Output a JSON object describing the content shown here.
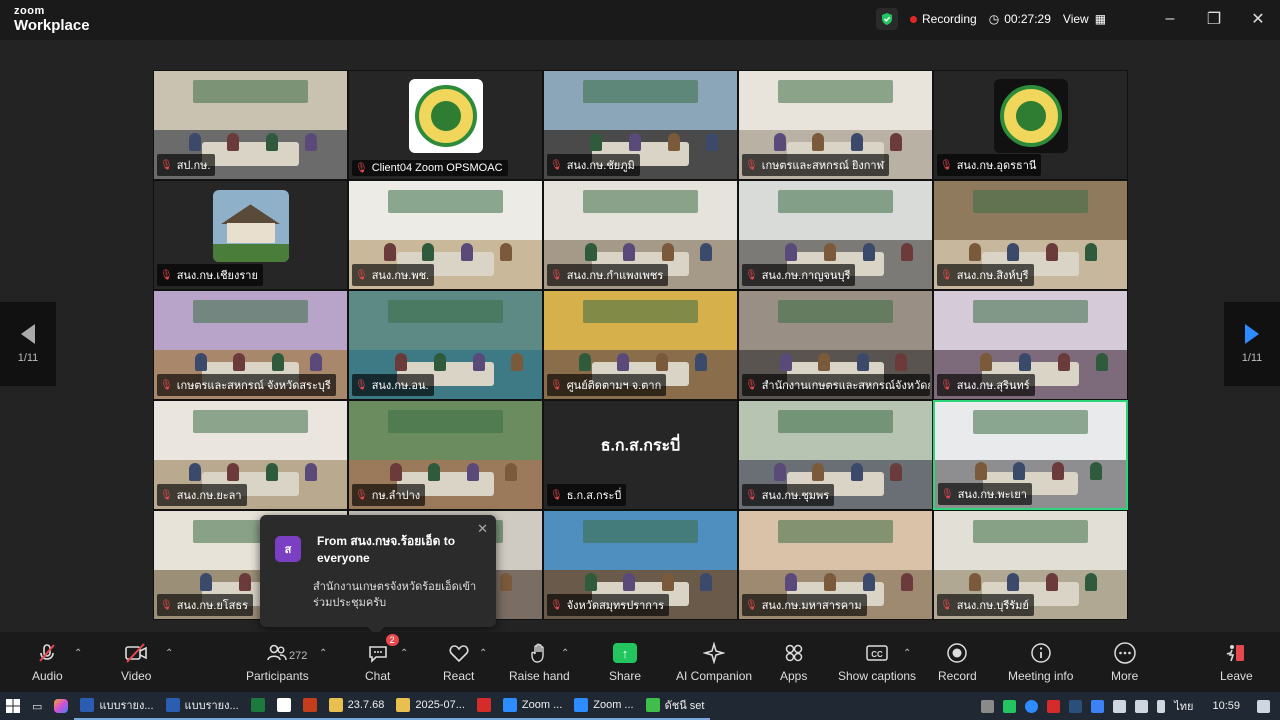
{
  "app": {
    "brand_top": "zoom",
    "brand_bottom": "Workplace"
  },
  "header": {
    "recording": "Recording",
    "timer": "00:27:29",
    "view": "View"
  },
  "gallery": {
    "page_left": "1/11",
    "page_right": "1/11",
    "tiles": [
      {
        "name": "สป.กษ.",
        "kind": "room",
        "wall": "#c9c2b0",
        "floor": "#6b6b6b"
      },
      {
        "name": "Client04 Zoom OPSMOAC",
        "kind": "logo"
      },
      {
        "name": "สนง.กษ.ชัยภูมิ",
        "kind": "room",
        "wall": "#8aa6b8",
        "floor": "#4a4a4a"
      },
      {
        "name": "เกษตรและสหกรณ์ ยิงกาฬ",
        "kind": "room",
        "wall": "#e8e4dc",
        "floor": "#b9b2a4"
      },
      {
        "name": "สนง.กษ.อุดรธานี",
        "kind": "logo-dark"
      },
      {
        "name": "สนง.กษ.เชียงราย",
        "kind": "house"
      },
      {
        "name": "สนง.กษ.พช.",
        "kind": "room",
        "wall": "#ecebe6",
        "floor": "#c9b89a"
      },
      {
        "name": "สนง.กษ.กำแพงเพชร",
        "kind": "room",
        "wall": "#e6e3dc",
        "floor": "#a59a88"
      },
      {
        "name": "สนง.กษ.กาญจนบุรี",
        "kind": "room",
        "wall": "#d9dbd8",
        "floor": "#7c7a76"
      },
      {
        "name": "สนง.กษ.สิงห์บุรี",
        "kind": "room",
        "wall": "#8f7a5e",
        "floor": "#c7b79c"
      },
      {
        "name": "เกษตรและสหกรณ์ จังหวัดสระบุรี",
        "kind": "room",
        "wall": "#b8a4c8",
        "floor": "#a8876a"
      },
      {
        "name": "สนง.กษ.อน.",
        "kind": "room",
        "wall": "#5e8a86",
        "floor": "#3d7a86"
      },
      {
        "name": "ศูนย์ติดตามฯ จ.ตาก",
        "kind": "room",
        "wall": "#d6b04a",
        "floor": "#8a6d4a"
      },
      {
        "name": "สำนักงานเกษตรและสหกรณ์จังหวัดกาฬ...",
        "kind": "room",
        "wall": "#9a8f84",
        "floor": "#5a5450"
      },
      {
        "name": "สนง.กษ.สุรินทร์",
        "kind": "room",
        "wall": "#d5cbd8",
        "floor": "#7d6a7a"
      },
      {
        "name": "สนง.กษ.ยะลา",
        "kind": "room",
        "wall": "#eae6df",
        "floor": "#b8a98f"
      },
      {
        "name": "กษ.ลำปาง",
        "kind": "room",
        "wall": "#6b8c5e",
        "floor": "#9a7a5a"
      },
      {
        "name": "ธ.ก.ส.กระบี่",
        "kind": "text",
        "label": "ธ.ก.ส.กระบี่"
      },
      {
        "name": "สนง.กษ.ชุมพร",
        "kind": "room",
        "wall": "#b7c4b2",
        "floor": "#6a6f75"
      },
      {
        "name": "สนง.กษ.พะเยา",
        "kind": "room",
        "wall": "#e9eaec",
        "floor": "#8e8e90",
        "active": true
      },
      {
        "name": "สนง.กษ.ยโสธร",
        "kind": "room",
        "wall": "#e7e3d8",
        "floor": "#9c8f78"
      },
      {
        "name": "ียงใหม่",
        "kind": "room",
        "wall": "#cfcac2",
        "floor": "#7a6e64"
      },
      {
        "name": "จังหวัดสมุทรปราการ",
        "kind": "room",
        "wall": "#4f8fbf",
        "floor": "#6a5a4a"
      },
      {
        "name": "สนง.กษ.มหาสารคาม",
        "kind": "room",
        "wall": "#d9c2a8",
        "floor": "#9e8a70"
      },
      {
        "name": "สนง.กษ.บุรีรัมย์",
        "kind": "room",
        "wall": "#e2dfd6",
        "floor": "#b1a894"
      }
    ]
  },
  "chat_toast": {
    "from": "From สนง.กษจ.ร้อยเอ็ด to everyone",
    "icon_letter": "ส",
    "message": "สำนักงานเกษตรจังหวัดร้อยเอ็ดเข้าร่วมประชุมครับ"
  },
  "toolbar": {
    "audio": "Audio",
    "video": "Video",
    "participants": "Participants",
    "participants_count": "272",
    "chat": "Chat",
    "chat_badge": "2",
    "react": "React",
    "raise_hand": "Raise hand",
    "share": "Share",
    "ai_companion": "AI Companion",
    "apps": "Apps",
    "show_captions": "Show captions",
    "record": "Record",
    "meeting_info": "Meeting info",
    "more": "More",
    "leave": "Leave"
  },
  "taskbar": {
    "items": [
      {
        "label": "แบบรายง...",
        "color": "#2b5eb3"
      },
      {
        "label": "แบบรายง...",
        "color": "#2b5eb3"
      },
      {
        "label": "",
        "color": "#1d7a3f"
      },
      {
        "label": "",
        "color": "#ffffff"
      },
      {
        "label": "",
        "color": "#c43e1c"
      },
      {
        "label": "23.7.68",
        "color": "#e8c050"
      },
      {
        "label": "2025-07...",
        "color": "#e8c050"
      },
      {
        "label": "",
        "color": "#d62b2b"
      },
      {
        "label": "Zoom ...",
        "color": "#2d8cff"
      },
      {
        "label": "Zoom ...",
        "color": "#2d8cff"
      },
      {
        "label": "ดัชนี set",
        "color": "#3fbf4a"
      }
    ],
    "lang": "ไทย",
    "time": "10:59"
  }
}
